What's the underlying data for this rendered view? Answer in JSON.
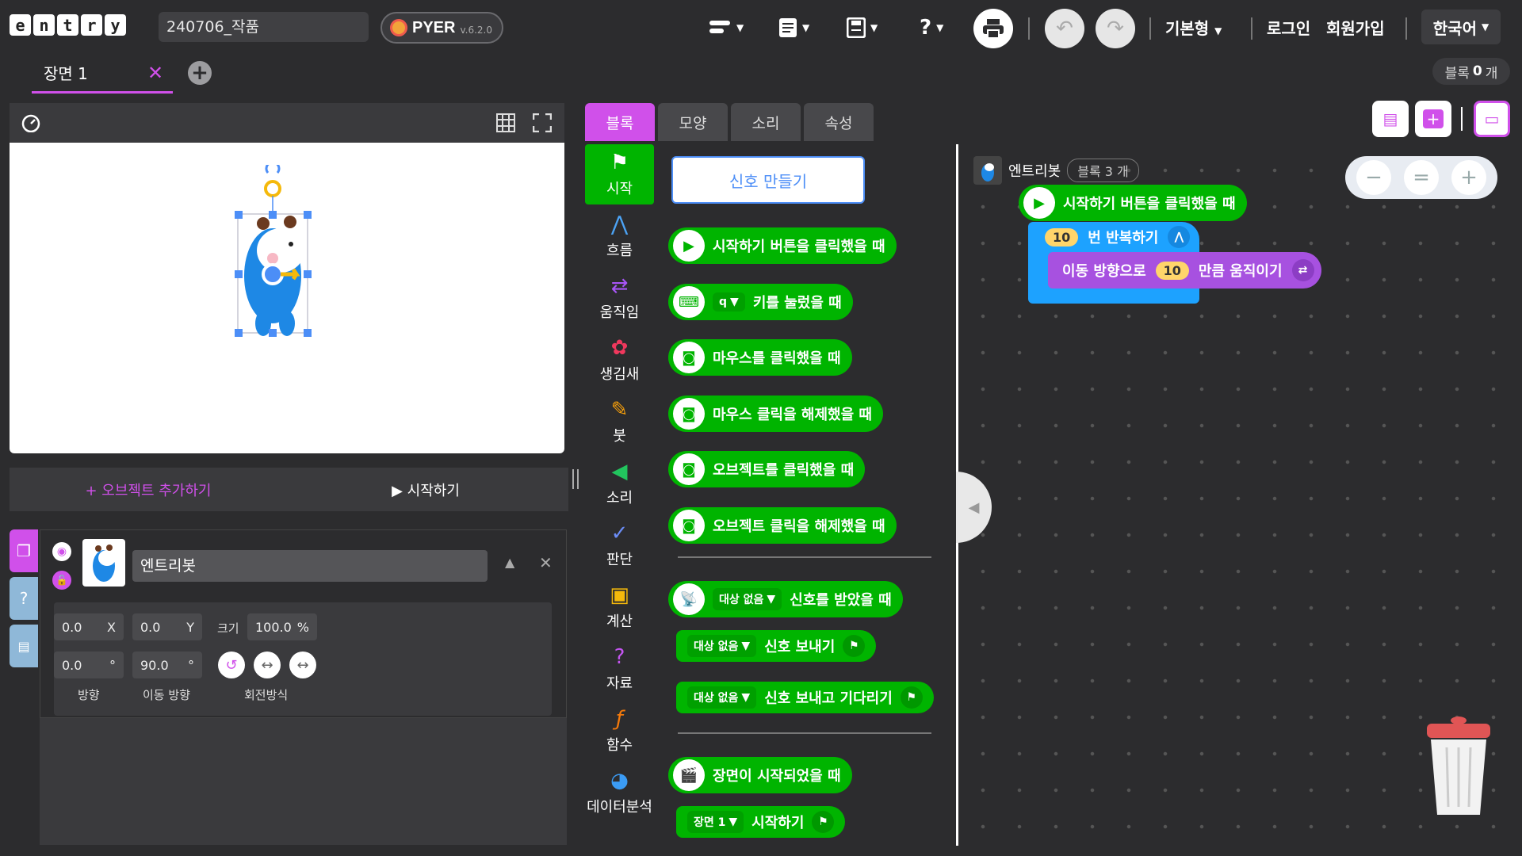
{
  "header": {
    "logo_letters": [
      "e",
      "n",
      "t",
      "r",
      "y"
    ],
    "project_name": "240706_작품",
    "pyer_label": "PYER",
    "pyer_version": "v.6.2.0",
    "menu_basic": "기본형",
    "login": "로그인",
    "signup": "회원가입",
    "language": "한국어"
  },
  "scene": {
    "tab_label": "장면 1",
    "block_count_prefix": "블록",
    "block_count_value": "0",
    "block_count_suffix": "개"
  },
  "stage": {
    "add_object": "+ 오브젝트 추가하기",
    "start": "▶ 시작하기"
  },
  "object": {
    "name": "엔트리봇",
    "x": "0.0",
    "x_label": "X",
    "y": "0.0",
    "y_label": "Y",
    "size_label": "크기",
    "size": "100.0",
    "size_unit": "%",
    "direction": "0.0",
    "move_direction": "90.0",
    "degree": "°",
    "direction_label": "방향",
    "move_direction_label": "이동 방향",
    "rotation_label": "회전방식"
  },
  "tabs": [
    "블록",
    "모양",
    "소리",
    "속성"
  ],
  "categories": [
    {
      "label": "시작",
      "icon": "flag-icon",
      "color": "#ffffff"
    },
    {
      "label": "흐름",
      "icon": "flow-icon",
      "color": "#4ca3f5"
    },
    {
      "label": "움직임",
      "icon": "arrows-icon",
      "color": "#a855f7"
    },
    {
      "label": "생김새",
      "icon": "looks-icon",
      "color": "#f0385d"
    },
    {
      "label": "붓",
      "icon": "brush-icon",
      "color": "#f59e0b"
    },
    {
      "label": "소리",
      "icon": "speaker-icon",
      "color": "#22c55e"
    },
    {
      "label": "판단",
      "icon": "check-icon",
      "color": "#6b8cf5"
    },
    {
      "label": "계산",
      "icon": "calc-icon",
      "color": "#f5b90b"
    },
    {
      "label": "자료",
      "icon": "question-icon",
      "color": "#c455f0"
    },
    {
      "label": "함수",
      "icon": "function-icon",
      "color": "#f57a0b"
    },
    {
      "label": "데이터분석",
      "icon": "pie-icon",
      "color": "#3b9cf5"
    }
  ],
  "palette": {
    "make_signal": "신호 만들기",
    "blocks": [
      "시작하기 버튼을 클릭했을 때",
      "키를 눌렀을 때",
      "마우스를 클릭했을 때",
      "마우스 클릭을 해제했을 때",
      "오브젝트를 클릭했을 때",
      "오브젝트 클릭을 해제했을 때",
      "신호를 받았을 때",
      "신호 보내기",
      "신호 보내고 기다리기",
      "장면이 시작되었을 때",
      "시작하기"
    ],
    "key_value": "q",
    "signal_target": "대상 없음",
    "scene_value": "장면 1"
  },
  "workspace": {
    "object_name": "엔트리봇",
    "block_count": "블록 3 개",
    "script": {
      "hat": "시작하기 버튼을 클릭했을 때",
      "repeat_count": "10",
      "repeat_label": "번 반복하기",
      "move_prefix": "이동 방향으로",
      "move_value": "10",
      "move_suffix": "만큼 움직이기"
    }
  }
}
